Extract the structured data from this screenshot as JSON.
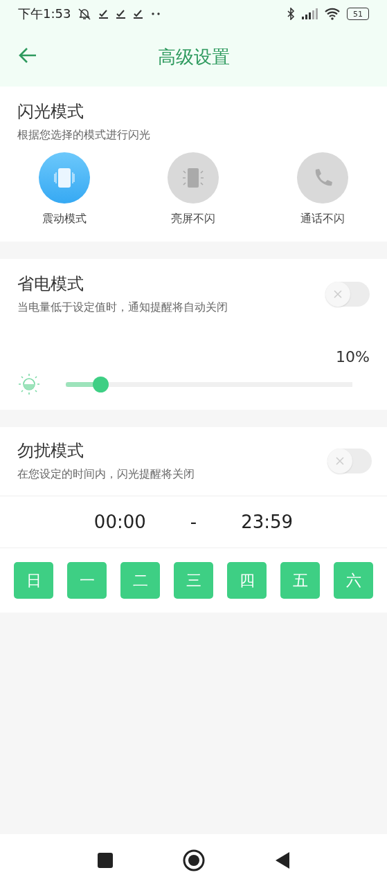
{
  "status_bar": {
    "time": "下午1:53",
    "battery": "51"
  },
  "header": {
    "title": "高级设置"
  },
  "flash_mode": {
    "title": "闪光模式",
    "subtitle": "根据您选择的模式进行闪光",
    "modes": [
      {
        "kind": "vibrate",
        "label": "震动模式",
        "selected": true
      },
      {
        "kind": "screen",
        "label": "亮屏不闪",
        "selected": false
      },
      {
        "kind": "call",
        "label": "通话不闪",
        "selected": false
      }
    ]
  },
  "power_saving": {
    "title": "省电模式",
    "subtitle": "当电量低于设定值时，通知提醒将自动关闭",
    "on": false,
    "reading": "10%",
    "level": 0.1
  },
  "do_not_disturb": {
    "title": "勿扰模式",
    "subtitle": "在您设定的时间内，闪光提醒将关闭",
    "on": false,
    "start": "00:00",
    "separator": "-",
    "end": "23:59",
    "days": [
      {
        "label": "日",
        "selected": true
      },
      {
        "label": "一",
        "selected": true
      },
      {
        "label": "二",
        "selected": true
      },
      {
        "label": "三",
        "selected": true
      },
      {
        "label": "四",
        "selected": true
      },
      {
        "label": "五",
        "selected": true
      },
      {
        "label": "六",
        "selected": true
      }
    ]
  }
}
